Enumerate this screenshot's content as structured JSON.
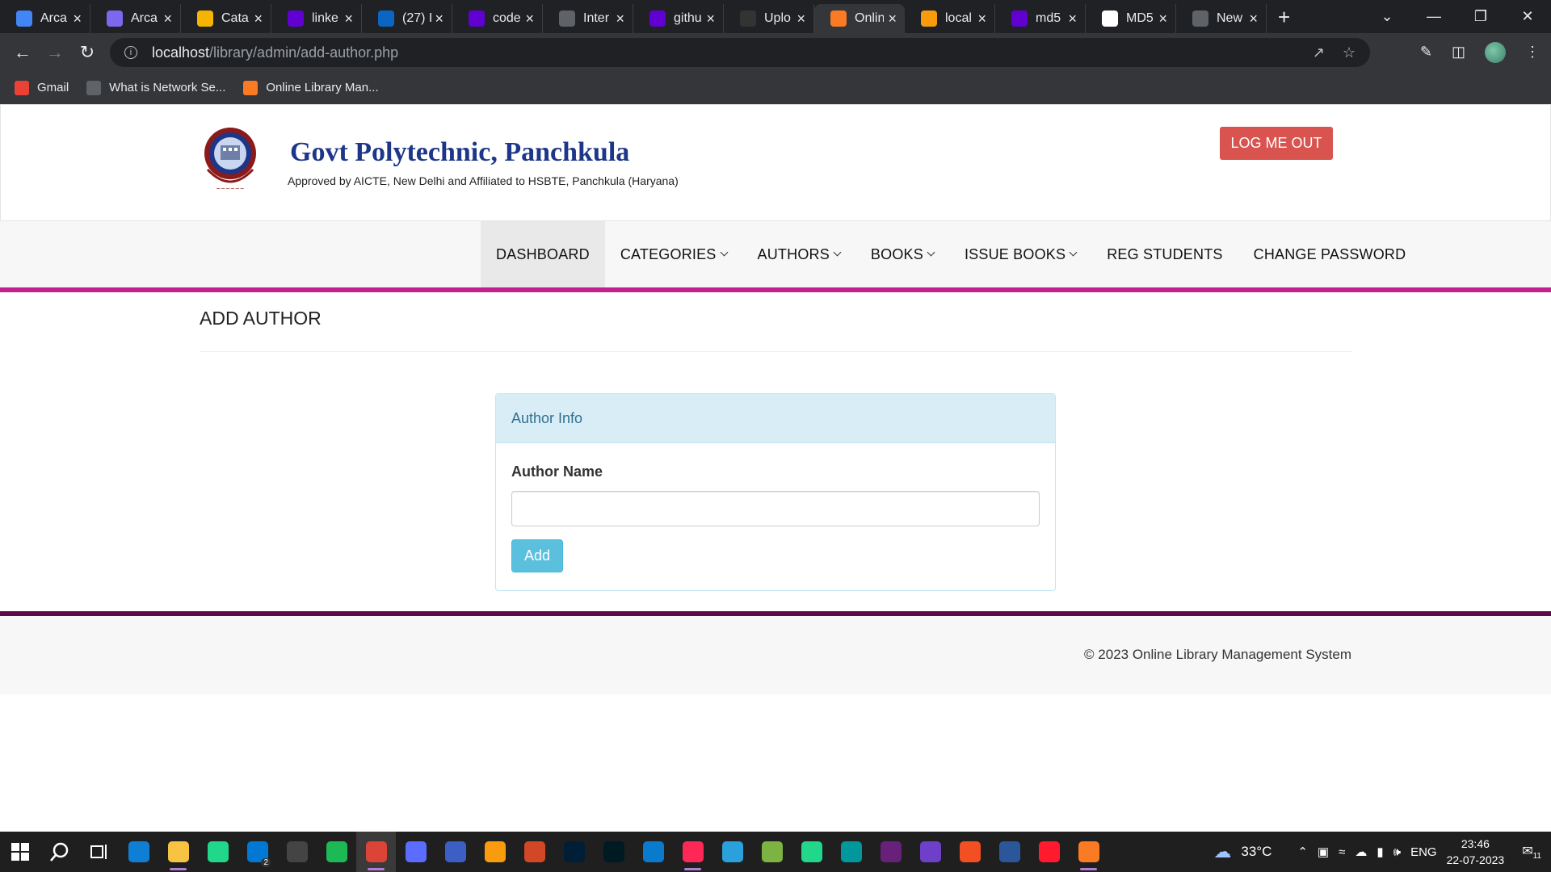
{
  "browser": {
    "tabs": [
      {
        "title": "Arca",
        "icon": "google-icon",
        "color": "#4285f4"
      },
      {
        "title": "Arca",
        "icon": "list-icon",
        "color": "#7b68ee"
      },
      {
        "title": "Cata",
        "icon": "cloud-icon",
        "color": "#f4b400"
      },
      {
        "title": "linke",
        "icon": "yahoo-icon",
        "color": "#6001d2"
      },
      {
        "title": "(27) I",
        "icon": "linkedin-icon",
        "color": "#0a66c2"
      },
      {
        "title": "code",
        "icon": "yahoo-icon",
        "color": "#6001d2"
      },
      {
        "title": "Inter",
        "icon": "globe-icon",
        "color": "#5f6368"
      },
      {
        "title": "githu",
        "icon": "yahoo-icon",
        "color": "#6001d2"
      },
      {
        "title": "Uplo",
        "icon": "github-icon",
        "color": "#333333"
      },
      {
        "title": "Onlin",
        "icon": "xampp-icon",
        "color": "#fb7a24",
        "active": true
      },
      {
        "title": "local",
        "icon": "phpmyadmin-icon",
        "color": "#f89c0e"
      },
      {
        "title": "md5",
        "icon": "yahoo-icon",
        "color": "#6001d2"
      },
      {
        "title": "MD5",
        "icon": "lock-icon",
        "color": "#ffffff"
      },
      {
        "title": "New",
        "icon": "globe-icon",
        "color": "#5f6368"
      }
    ],
    "url_host": "localhost",
    "url_path": "/library/admin/add-author.php",
    "bookmarks": [
      {
        "label": "Gmail",
        "icon": "gmail-icon",
        "color": "#ea4335"
      },
      {
        "label": "What is Network Se...",
        "icon": "globe-icon",
        "color": "#5f6368"
      },
      {
        "label": "Online Library Man...",
        "icon": "xampp-icon",
        "color": "#fb7a24"
      }
    ]
  },
  "site": {
    "college_name": "Govt Polytechnic, Panchkula",
    "college_subtitle": "Approved by AICTE, New Delhi and Affiliated to HSBTE, Panchkula (Haryana)",
    "logout_label": "LOG ME OUT",
    "menu": [
      {
        "label": "DASHBOARD",
        "dropdown": false,
        "active": true
      },
      {
        "label": "CATEGORIES",
        "dropdown": true
      },
      {
        "label": "AUTHORS",
        "dropdown": true
      },
      {
        "label": "BOOKS",
        "dropdown": true
      },
      {
        "label": "ISSUE BOOKS",
        "dropdown": true
      },
      {
        "label": "REG STUDENTS",
        "dropdown": false
      },
      {
        "label": "CHANGE PASSWORD",
        "dropdown": false
      }
    ],
    "page_title": "ADD AUTHOR",
    "panel_heading": "Author Info",
    "field_label": "Author Name",
    "field_value": "",
    "submit_label": "Add",
    "footer_text": "© 2023 Online Library Management System",
    "accent_color": "#c41f8e",
    "logout_color": "#d9534f",
    "button_color": "#5bc0de"
  },
  "taskbar": {
    "apps": [
      {
        "name": "edge-icon",
        "color": "#0f7fd6"
      },
      {
        "name": "file-explorer-icon",
        "color": "#f6c343"
      },
      {
        "name": "clion-icon",
        "color": "#21d789"
      },
      {
        "name": "mail-icon",
        "color": "#0078d4",
        "badge": "2"
      },
      {
        "name": "dell-icon",
        "color": "#444444"
      },
      {
        "name": "spotify-icon",
        "color": "#1db954"
      },
      {
        "name": "chrome-icon",
        "color": "#db4437"
      },
      {
        "name": "app-icon",
        "color": "#5b6cff"
      },
      {
        "name": "dev-icon",
        "color": "#3b5fc4"
      },
      {
        "name": "phpmyadmin-icon",
        "color": "#f89c0e"
      },
      {
        "name": "powerpoint-icon",
        "color": "#d24726"
      },
      {
        "name": "photoshop-icon",
        "color": "#001e36"
      },
      {
        "name": "lightroom-icon",
        "color": "#001a24"
      },
      {
        "name": "vscode-icon",
        "color": "#0a7acc"
      },
      {
        "name": "intellij-icon",
        "color": "#fe2857"
      },
      {
        "name": "telegram-icon",
        "color": "#2aa1da"
      },
      {
        "name": "vim-icon",
        "color": "#7cb342"
      },
      {
        "name": "pycharm-icon",
        "color": "#21d789"
      },
      {
        "name": "arduino-icon",
        "color": "#00979d"
      },
      {
        "name": "vs-icon",
        "color": "#68217a"
      },
      {
        "name": "github-desktop-icon",
        "color": "#6e40c9"
      },
      {
        "name": "app2-icon",
        "color": "#f25022"
      },
      {
        "name": "word-icon",
        "color": "#2b579a"
      },
      {
        "name": "opera-icon",
        "color": "#ff1b2d"
      },
      {
        "name": "xampp-icon",
        "color": "#fb7a24"
      }
    ],
    "weather": "33°C",
    "language": "ENG",
    "time": "23:46",
    "date": "22-07-2023",
    "notifications": "11"
  }
}
